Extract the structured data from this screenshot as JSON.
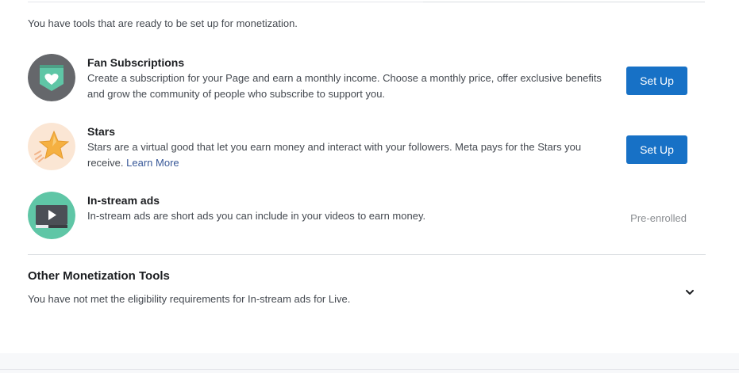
{
  "intro_text": "You have tools that are ready to be set up for monetization.",
  "tools": [
    {
      "title": "Fan Subscriptions",
      "description": "Create a subscription for your Page and earn a monthly income. Choose a monthly price, offer exclusive benefits and grow the community of people who subscribe to support you.",
      "action_label": "Set Up"
    },
    {
      "title": "Stars",
      "description": "Stars are a virtual good that let you earn money and interact with your followers. Meta pays for the Stars you receive.",
      "link_label": "Learn More",
      "action_label": "Set Up"
    },
    {
      "title": "In-stream ads",
      "description": "In-stream ads are short ads you can include in your videos to earn money.",
      "status_label": "Pre-enrolled"
    }
  ],
  "other_tools": {
    "title": "Other Monetization Tools",
    "description": "You have not met the eligibility requirements for In-stream ads for Live."
  },
  "colors": {
    "primary_button": "#1771c6",
    "fan_icon_bg": "#65676b",
    "fan_icon_badge": "#5fc6a6",
    "stars_icon_bg": "#fbe6d4",
    "stars_icon_star": "#f5b041",
    "instream_icon_bg": "#5fc6a6",
    "instream_icon_screen": "#4b4f56"
  },
  "icons": {
    "fan_subscriptions": "heart-badge-icon",
    "stars": "star-icon",
    "instream_ads": "video-play-icon",
    "expand": "chevron-down-icon"
  }
}
